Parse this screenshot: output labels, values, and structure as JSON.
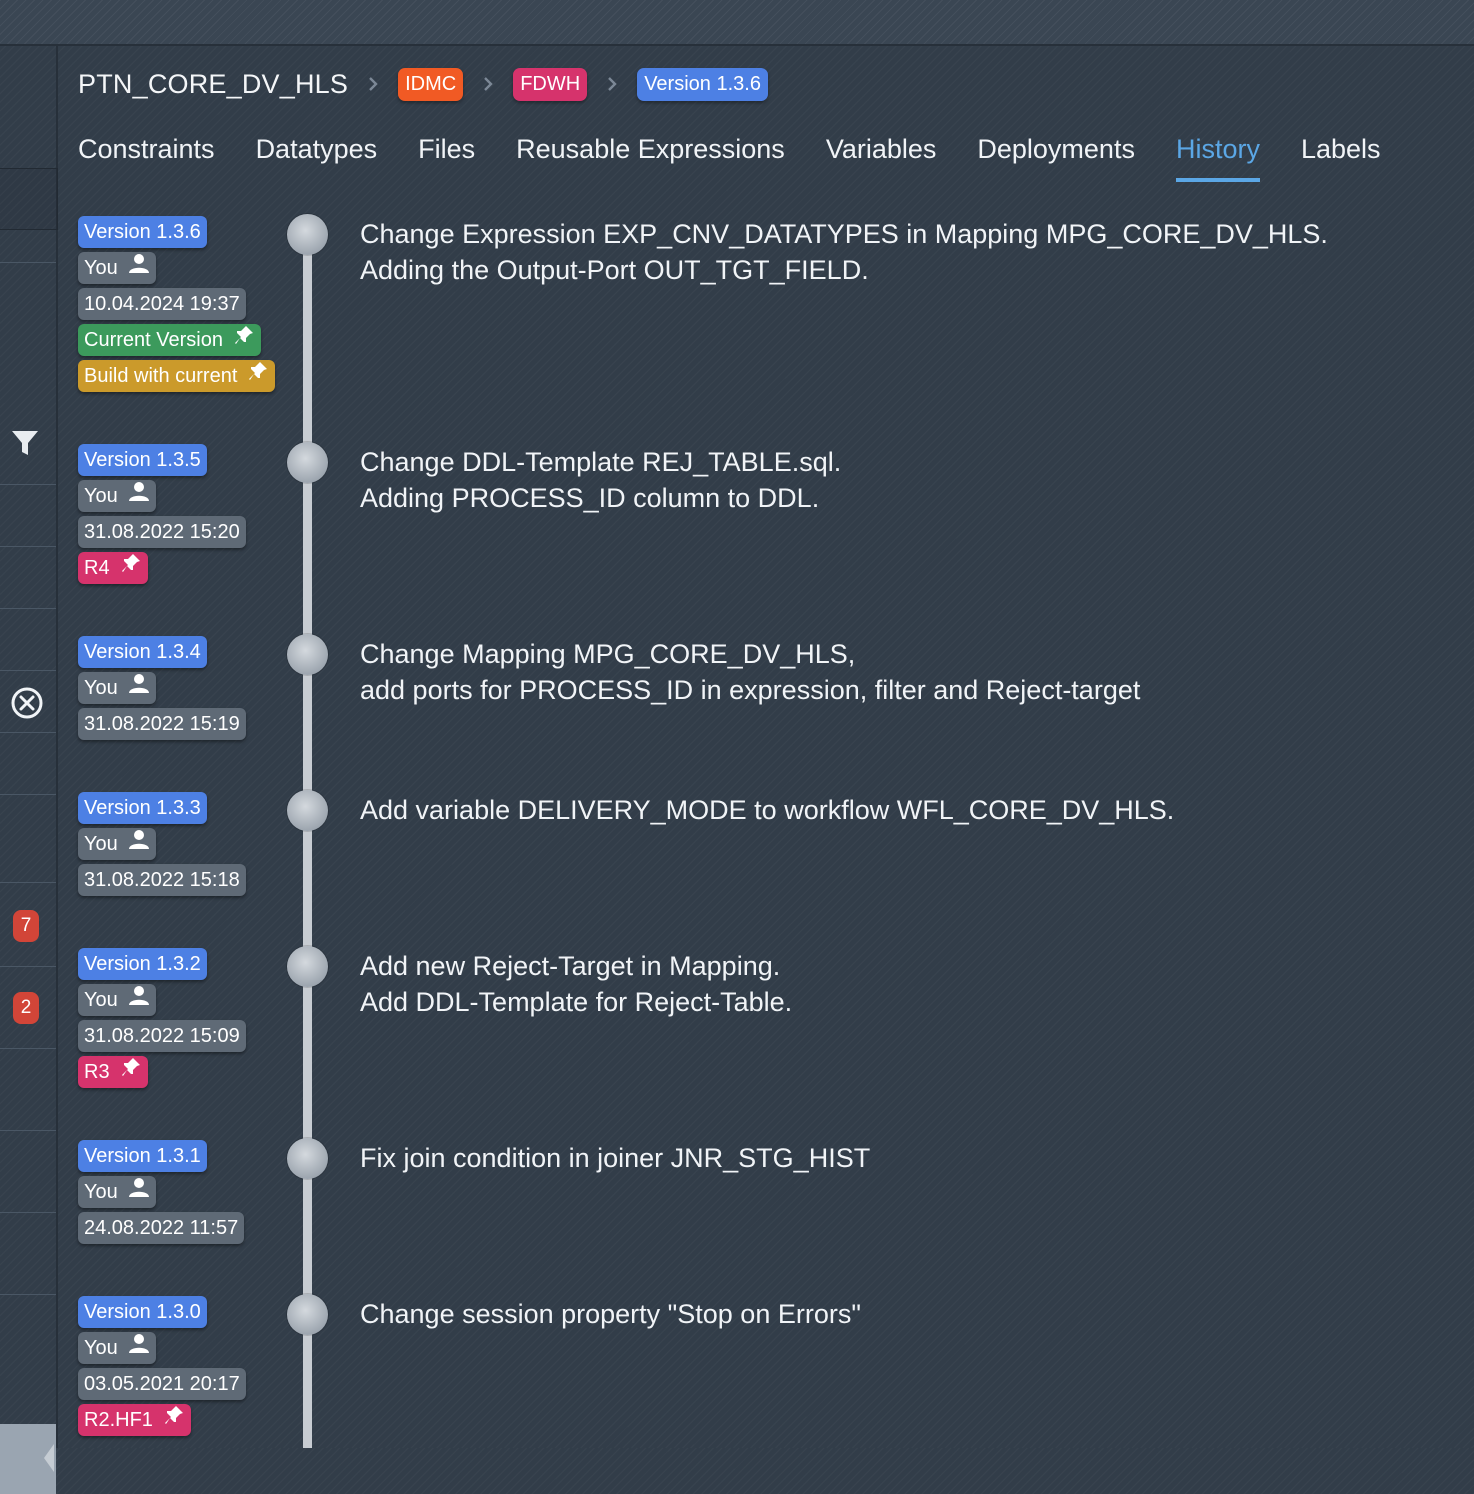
{
  "breadcrumb": {
    "project": "PTN_CORE_DV_HLS",
    "tags": [
      {
        "label": "IDMC",
        "color": "#f15a24"
      },
      {
        "label": "FDWH",
        "color": "#d6336c"
      },
      {
        "label": "Version 1.3.6",
        "color": "#4d80e4"
      }
    ]
  },
  "tabs": [
    {
      "label": "Constraints"
    },
    {
      "label": "Datatypes"
    },
    {
      "label": "Files"
    },
    {
      "label": "Reusable Expressions"
    },
    {
      "label": "Variables"
    },
    {
      "label": "Deployments"
    },
    {
      "label": "History",
      "active": true
    },
    {
      "label": "Labels"
    }
  ],
  "sidebar": {
    "icons": [
      "filter-icon",
      "close-circle-icon"
    ],
    "badges": [
      "7",
      "2"
    ]
  },
  "history": [
    {
      "version": "Version 1.3.6",
      "user": "You",
      "date": "10.04.2024 19:37",
      "labels": [
        {
          "text": "Current Version",
          "kind": "current"
        },
        {
          "text": "Build with current",
          "kind": "build"
        }
      ],
      "lines": [
        "Change Expression EXP_CNV_DATATYPES in Mapping MPG_CORE_DV_HLS.",
        "Adding the Output-Port OUT_TGT_FIELD."
      ]
    },
    {
      "version": "Version 1.3.5",
      "user": "You",
      "date": "31.08.2022 15:20",
      "labels": [
        {
          "text": "R4",
          "kind": "release"
        }
      ],
      "lines": [
        "Change DDL-Template REJ_TABLE.sql.",
        "Adding PROCESS_ID column to DDL."
      ]
    },
    {
      "version": "Version 1.3.4",
      "user": "You",
      "date": "31.08.2022 15:19",
      "labels": [],
      "lines": [
        "Change Mapping MPG_CORE_DV_HLS,",
        "add ports for PROCESS_ID in expression, filter and Reject-target"
      ]
    },
    {
      "version": "Version 1.3.3",
      "user": "You",
      "date": "31.08.2022 15:18",
      "labels": [],
      "lines": [
        "Add variable DELIVERY_MODE to workflow WFL_CORE_DV_HLS."
      ]
    },
    {
      "version": "Version 1.3.2",
      "user": "You",
      "date": "31.08.2022 15:09",
      "labels": [
        {
          "text": "R3",
          "kind": "release"
        }
      ],
      "lines": [
        "Add new Reject-Target in Mapping.",
        "Add DDL-Template for Reject-Table."
      ]
    },
    {
      "version": "Version 1.3.1",
      "user": "You",
      "date": "24.08.2022 11:57",
      "labels": [],
      "lines": [
        "Fix join condition in joiner JNR_STG_HIST"
      ]
    },
    {
      "version": "Version 1.3.0",
      "user": "You",
      "date": "03.05.2021 20:17",
      "labels": [
        {
          "text": "R2.HF1",
          "kind": "release"
        }
      ],
      "lines": [
        "Change session property \"Stop on Errors\""
      ]
    }
  ],
  "icons": {
    "user": "user-icon",
    "pin": "pin-icon",
    "separator": "chevron-right-icon"
  }
}
